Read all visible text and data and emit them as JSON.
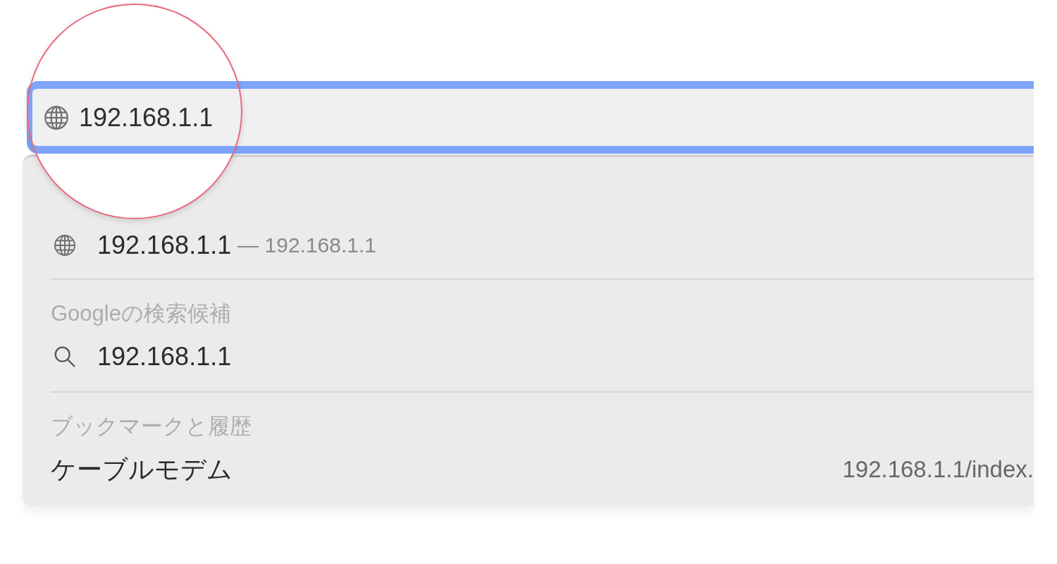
{
  "address_bar": {
    "value": "192.168.1.1",
    "focused": true
  },
  "suggestions": {
    "sections": [
      {
        "items": [
          {
            "kind": "url",
            "title": "192.168.1.1",
            "subtitle": "— 192.168.1.1"
          }
        ]
      },
      {
        "heading": "Googleの検索候補",
        "items": [
          {
            "kind": "search",
            "title": "192.168.1.1"
          }
        ]
      },
      {
        "heading": "ブックマークと履歴",
        "items": [
          {
            "kind": "bookmark",
            "title": "ケーブルモデム",
            "url": "192.168.1.1/index."
          }
        ]
      }
    ]
  }
}
